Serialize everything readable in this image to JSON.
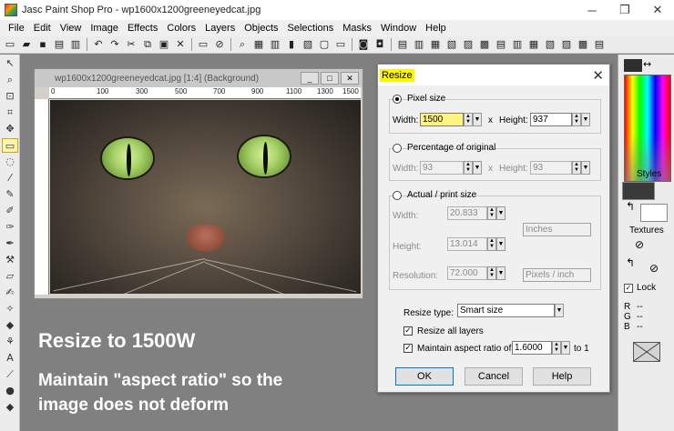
{
  "window": {
    "title": "Jasc Paint Shop Pro - wp1600x1200greeneyedcat.jpg",
    "minimize": "─",
    "maximize": "❐",
    "close": "✕"
  },
  "menu": [
    "File",
    "Edit",
    "View",
    "Image",
    "Effects",
    "Colors",
    "Layers",
    "Objects",
    "Selections",
    "Masks",
    "Window",
    "Help"
  ],
  "image_window": {
    "title": "wp1600x1200greeneyedcat.jpg [1:4] (Background)",
    "ruler_ticks": [
      "0",
      "100",
      "300",
      "500",
      "700",
      "900",
      "1100",
      "1300",
      "1500"
    ]
  },
  "captions": {
    "line1": "Resize to 1500W",
    "line2": "Maintain \"aspect ratio\" so the image does not deform"
  },
  "palette": {
    "styles_label": "Styles",
    "textures_label": "Textures",
    "lock_label": "Lock",
    "rgb": [
      "R",
      "G",
      "B"
    ],
    "rgb_values": [
      "--",
      "--",
      "--"
    ]
  },
  "dialog": {
    "title": "Resize",
    "pixel_size": {
      "label": "Pixel size",
      "width_label": "Width:",
      "width_value": "1500",
      "x_sep": "x",
      "height_label": "Height:",
      "height_value": "937"
    },
    "percentage": {
      "label": "Percentage of original",
      "width_label": "Width:",
      "width_value": "93",
      "x_sep": "x",
      "height_label": "Height:",
      "height_value": "93"
    },
    "actual": {
      "label": "Actual / print size",
      "width_label": "Width:",
      "width_value": "20.833",
      "height_label": "Height:",
      "height_value": "13.014",
      "units_value": "Inches",
      "resolution_label": "Resolution:",
      "resolution_value": "72.000",
      "resolution_units": "Pixels / inch"
    },
    "resize_type_label": "Resize type:",
    "resize_type_value": "Smart size",
    "resize_all_layers": "Resize all layers",
    "maintain_aspect": "Maintain aspect ratio of:",
    "aspect_value": "1.6000",
    "aspect_suffix": "to 1",
    "ok": "OK",
    "cancel": "Cancel",
    "help": "Help"
  }
}
